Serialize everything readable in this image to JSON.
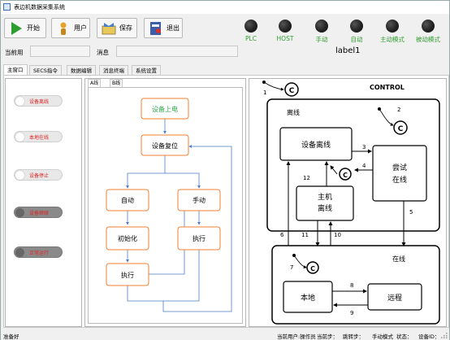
{
  "window": {
    "title": "表边机数据采集系统",
    "app_icon": "app-window-icon"
  },
  "toolbar": {
    "buttons": [
      {
        "label": "开始",
        "icon": "play-icon",
        "color": "#2e9e2e"
      },
      {
        "label": "用户",
        "icon": "user-icon",
        "color": "#e8a02a"
      },
      {
        "label": "保存",
        "icon": "save-icon",
        "color": "#4a7fc8"
      },
      {
        "label": "退出",
        "icon": "exit-icon",
        "color": "#e0302a"
      }
    ]
  },
  "lamps": [
    {
      "label": "PLC"
    },
    {
      "label": "HOST"
    },
    {
      "label": "手动"
    },
    {
      "label": "自动"
    },
    {
      "label": "主动模式"
    },
    {
      "label": "被动模式"
    }
  ],
  "lamp_label_color": "#2e9e2e",
  "info": {
    "current_user_label": "当前用",
    "current_user_value": "",
    "message_label": "消息",
    "message_value": "",
    "status_label": "label1"
  },
  "tabs": [
    "主窗口",
    "SECS指令",
    "数据编辑",
    "消息终端",
    "系统设置"
  ],
  "active_tab": "主窗口",
  "toggles": [
    {
      "label": "设备离线",
      "state": "off"
    },
    {
      "label": "本地在线",
      "state": "off"
    },
    {
      "label": "设备停止",
      "state": "off"
    },
    {
      "label": "设备继续",
      "state": "on"
    },
    {
      "label": "正常运行",
      "state": "on"
    }
  ],
  "toggle_label_color": "#e02020",
  "flow": {
    "subtabs": [
      "A线",
      "B线"
    ],
    "active_subtab": "A线",
    "nodes": {
      "power_on": "设备上电",
      "reset": "设备复位",
      "auto": "自动",
      "manual": "手动",
      "init": "初始化",
      "exec_auto": "执行",
      "exec_manual": "执行"
    },
    "start_color": "#2ea84a",
    "node_border_color": "#f08030",
    "edge_color": "#4a7fc8"
  },
  "control": {
    "title": "CONTROL",
    "offline": "离线",
    "equipment_offline": "设备离线",
    "attempt_online_1": "尝试",
    "attempt_online_2": "在线",
    "host_offline_1": "主机",
    "host_offline_2": "离线",
    "online": "在线",
    "local": "本地",
    "remote": "远程",
    "history_symbol": "C",
    "transitions": [
      "1",
      "2",
      "3",
      "4",
      "5",
      "6",
      "7",
      "8",
      "9",
      "10",
      "11",
      "12"
    ]
  },
  "statusbar": {
    "ready": "准备好",
    "items": [
      "当前用户:操作员",
      "当前步：",
      "跳转步：",
      "手动模式",
      "状态：",
      "设备ID："
    ]
  }
}
